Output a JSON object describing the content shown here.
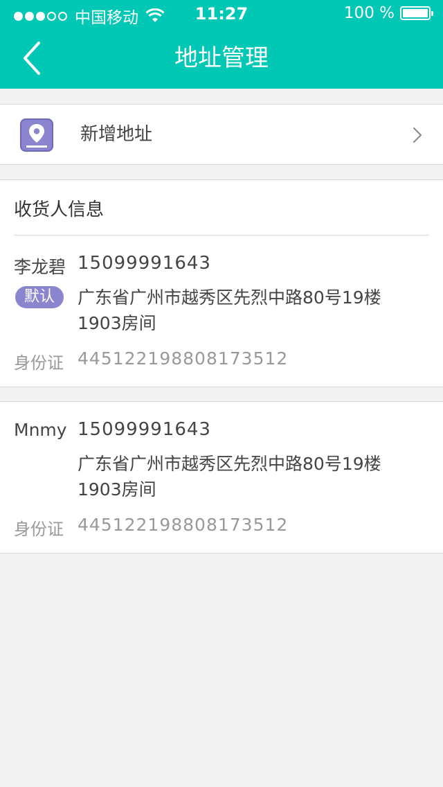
{
  "status_bar": {
    "carrier": "中国移动",
    "time": "11:27",
    "battery": "100 %",
    "signal_filled": 3,
    "signal_total": 5
  },
  "nav": {
    "title": "地址管理",
    "back_icon": "chevron-left-icon"
  },
  "add_address": {
    "label": "新增地址",
    "icon": "location-pin-icon",
    "icon_color": "#8b84cf"
  },
  "section": {
    "header": "收货人信息"
  },
  "addresses": [
    {
      "name": "李龙碧",
      "phone": "15099991643",
      "default_label": "默认",
      "address": "广东省广州市越秀区先烈中路80号19楼1903房间",
      "id_label": "身份证",
      "id_number": "445122198808173512"
    },
    {
      "name": "Mnmy",
      "phone": "15099991643",
      "address": "广东省广州市越秀区先烈中路80号19楼1903房间",
      "id_label": "身份证",
      "id_number": "445122198808173512"
    }
  ],
  "colors": {
    "accent": "#00c8b4",
    "badge": "#8b84cf",
    "background": "#f2f2f2"
  }
}
